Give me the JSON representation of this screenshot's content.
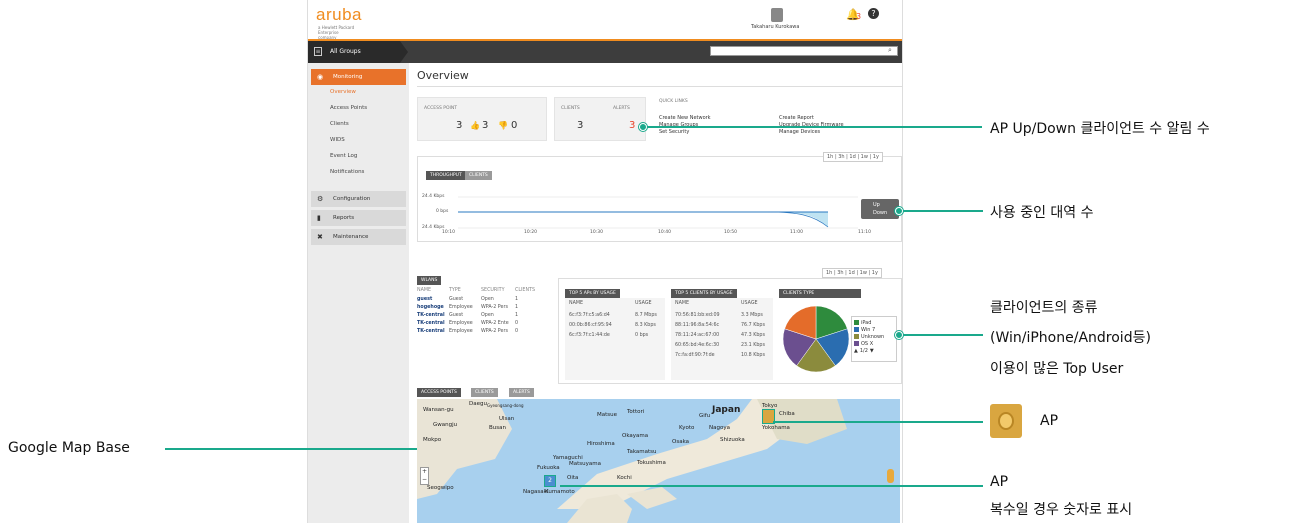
{
  "app": {
    "logo": "aruba",
    "logo_sub": "a Hewlett Packard Enterprise company",
    "user_name": "Takaharu Kurokawa",
    "alert_count": "3",
    "help": "?",
    "group_label": "All Groups",
    "colors": {
      "accent": "#f08c1f",
      "active_nav": "#e8722a",
      "alert": "#e8452c",
      "callout": "#1aa98c"
    }
  },
  "sidebar": {
    "monitoring": "Monitoring",
    "items": [
      "Overview",
      "Access Points",
      "Clients",
      "WIDS",
      "Event Log",
      "Notifications"
    ],
    "configuration": "Configuration",
    "reports": "Reports",
    "maintenance": "Maintenance"
  },
  "overview": {
    "title": "Overview",
    "ap_label": "ACCESS POINT",
    "ap_total": "3",
    "ap_up": "3",
    "ap_down": "0",
    "clients_label": "CLIENTS",
    "clients_value": "3",
    "alerts_label": "ALERTS",
    "alerts_value": "3",
    "quick_links_label": "QUICK LINKS",
    "quick_links": [
      "Create New Network",
      "Manage Groups",
      "Set Security",
      "Create Report",
      "Upgrade Device Firmware",
      "Manage Devices"
    ]
  },
  "throughput": {
    "range": "1h | 3h | 1d | 1w | 1y",
    "tab_throughput": "THROUGHPUT",
    "tab_clients": "CLIENTS",
    "y_top": "24.4 Kbps",
    "y_mid": "0 bps",
    "y_bot": "24.4 Kbps",
    "x_ticks": [
      "10:10",
      "10:20",
      "10:30",
      "10:40",
      "10:50",
      "11:00",
      "11:10"
    ],
    "legend_up": "Up",
    "legend_down": "Down"
  },
  "wlans": {
    "range": "1h | 3h | 1d | 1w | 1y",
    "tab": "WLANS",
    "headers": [
      "NAME",
      "TYPE",
      "SECURITY",
      "CLIENTS"
    ],
    "rows": [
      [
        "guest",
        "Guest",
        "Open",
        "1"
      ],
      [
        "hogehoge",
        "Employee",
        "WPA-2 Pers",
        "1"
      ],
      [
        "TK-central",
        "Guest",
        "Open",
        "1"
      ],
      [
        "TK-central",
        "Employee",
        "WPA-2 Ente",
        "0"
      ],
      [
        "TK-central",
        "Employee",
        "WPA-2 Pers",
        "0"
      ]
    ]
  },
  "top_aps": {
    "tab": "TOP 5 APs BY USAGE",
    "headers": [
      "NAME",
      "USAGE"
    ],
    "rows": [
      [
        "6c:f3:7f:c5:a6:d4",
        "8.7 Mbps"
      ],
      [
        "00:0b:86:cf:95:94",
        "8.3 Kbps"
      ],
      [
        "6c:f3:7f:c1:44:de",
        "0 bps"
      ]
    ]
  },
  "top_clients": {
    "tab": "TOP 5 CLIENTS BY USAGE",
    "headers": [
      "NAME",
      "USAGE"
    ],
    "rows": [
      [
        "70:56:81:bb:ed:09",
        "3.3 Mbps"
      ],
      [
        "88:11:96:8a:54:6c",
        "76.7 Kbps"
      ],
      [
        "78:11:24:ac:67:00",
        "47.3 Kbps"
      ],
      [
        "60:65:bd:4e:6c:30",
        "23.1 Kbps"
      ],
      [
        "7c:fa:df:90:7f:de",
        "10.8 Kbps"
      ]
    ]
  },
  "clients_type": {
    "tab": "CLIENTS TYPE",
    "legend": [
      "iPad",
      "Win 7",
      "Unknown",
      "OS X"
    ],
    "page": "1/2",
    "colors": [
      "#2e8b3d",
      "#2a6db0",
      "#8b8b3d",
      "#6b4f8f",
      "#e46c2a",
      "#3a9fb5"
    ],
    "slices": [
      0.2,
      0.2,
      0.2,
      0.2,
      0.2
    ]
  },
  "map_panel": {
    "tabs": [
      "ACCESS POINTS",
      "CLIENTS",
      "ALERTS"
    ],
    "labels": [
      "Daegu",
      "Gyeongsang-dong",
      "Ulsan",
      "Wansan-gu",
      "Gwangju",
      "Busan",
      "Mokpo",
      "Matsue",
      "Tottori",
      "Japan",
      "Tokyo",
      "Chiba",
      "Gifu",
      "Kyoto",
      "Nagoya",
      "Yokohama",
      "Hiroshima",
      "Okayama",
      "Osaka",
      "Shizuoka",
      "Yamaguchi",
      "Takamatsu",
      "Fukuoka",
      "Matsuyama",
      "Tokushima",
      "Kochi",
      "Oita",
      "Nagasaki",
      "Kumamoto",
      "Seogwipo"
    ],
    "cluster_count": "2",
    "zoom_in": "+",
    "zoom_out": "−"
  },
  "callouts": {
    "ap_counts": "AP Up/Down 클라이언트 수 알림 수",
    "bandwidth": "사용 중인 대역 수",
    "client_type_1": "클라이언트의 종류",
    "client_type_2": "(Win/iPhone/Android등)",
    "client_type_3": "이용이 많은 Top User",
    "ap": "AP",
    "ap_multi_1": "AP",
    "ap_multi_2": "복수일 경우 숫자로 표시",
    "google_map": "Google Map Base"
  }
}
